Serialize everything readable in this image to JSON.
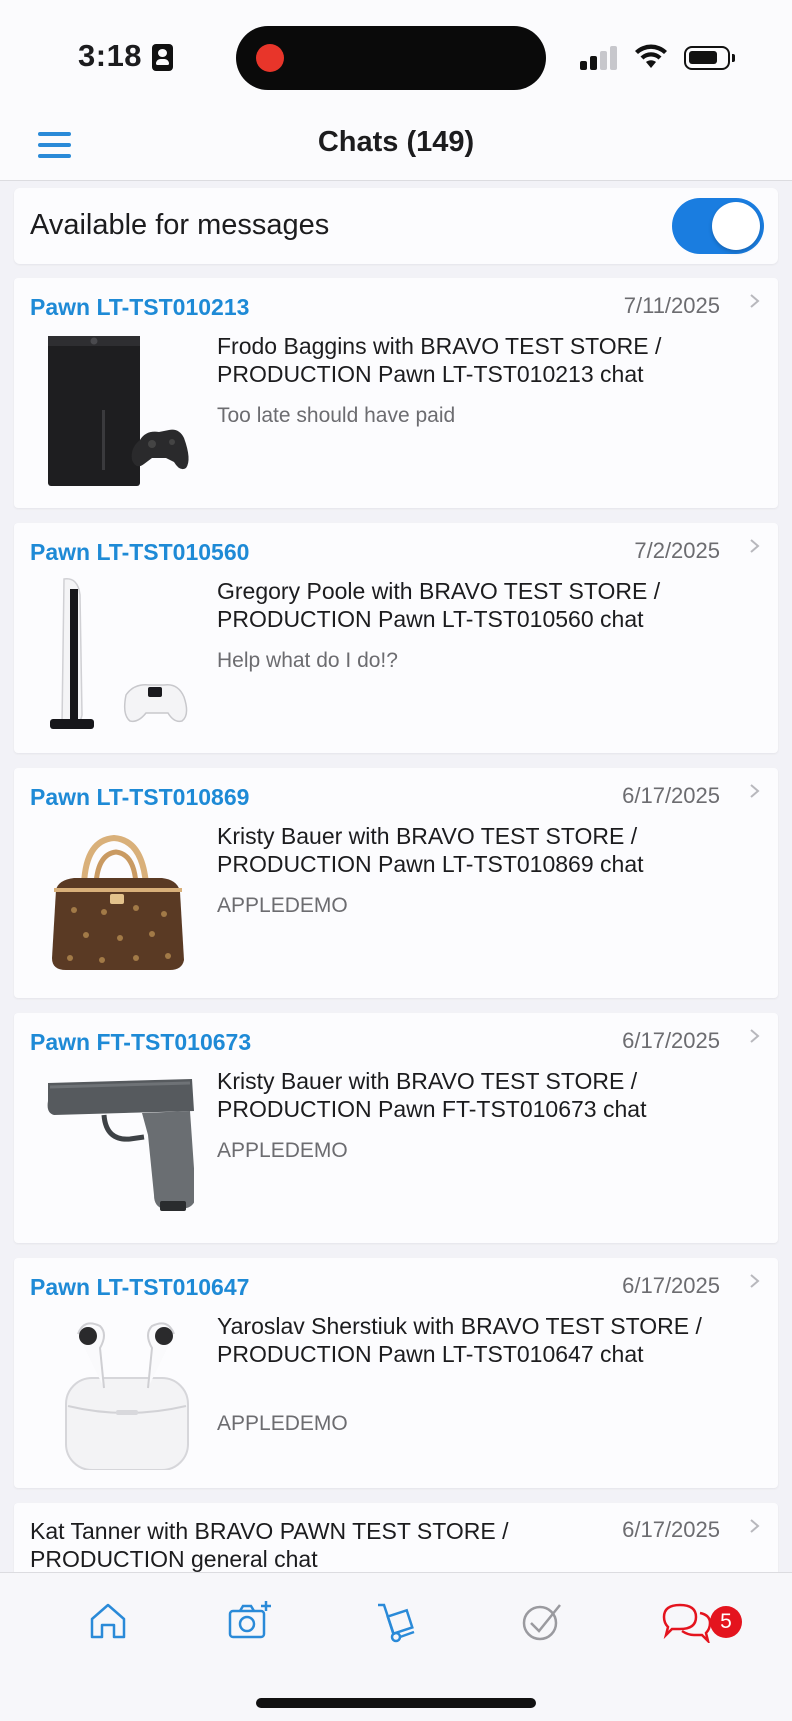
{
  "status_bar": {
    "time": "3:18"
  },
  "nav": {
    "title": "Chats (149)"
  },
  "availability": {
    "label": "Available for messages",
    "enabled": true
  },
  "chats": [
    {
      "ticket": "Pawn LT-TST010213",
      "date": "7/11/2025",
      "title": "Frodo Baggins with BRAVO TEST STORE / PRODUCTION Pawn LT-TST010213 chat",
      "last_message": "Too late should have paid",
      "thumbnail": "xbox-console-image"
    },
    {
      "ticket": "Pawn LT-TST010560",
      "date": "7/2/2025",
      "title": "Gregory Poole with BRAVO TEST STORE / PRODUCTION Pawn LT-TST010560 chat",
      "last_message": "Help what do I do!?",
      "thumbnail": "playstation-console-image"
    },
    {
      "ticket": "Pawn LT-TST010869",
      "date": "6/17/2025",
      "title": "Kristy Bauer with BRAVO TEST STORE / PRODUCTION Pawn LT-TST010869 chat",
      "last_message": "APPLEDEMO",
      "thumbnail": "handbag-image"
    },
    {
      "ticket": "Pawn FT-TST010673",
      "date": "6/17/2025",
      "title": "Kristy Bauer with BRAVO TEST STORE / PRODUCTION Pawn FT-TST010673 chat",
      "last_message": "APPLEDEMO",
      "thumbnail": "pistol-image"
    },
    {
      "ticket": "Pawn LT-TST010647",
      "date": "6/17/2025",
      "title": "Yaroslav Sherstiuk with BRAVO TEST STORE / PRODUCTION Pawn LT-TST010647 chat",
      "last_message": "APPLEDEMO",
      "thumbnail": "earbuds-image"
    }
  ],
  "general_chat": {
    "title": "Kat Tanner with BRAVO PAWN TEST STORE / PRODUCTION general chat",
    "date": "6/17/2025"
  },
  "tab_bar": {
    "tabs": [
      "home-icon",
      "camera-add-icon",
      "hand-truck-icon",
      "checkmark-icon",
      "chat-bubbles-icon"
    ],
    "chat_badge": "5",
    "accent_color": "#2a8ad8",
    "active_color": "#e4141e"
  }
}
